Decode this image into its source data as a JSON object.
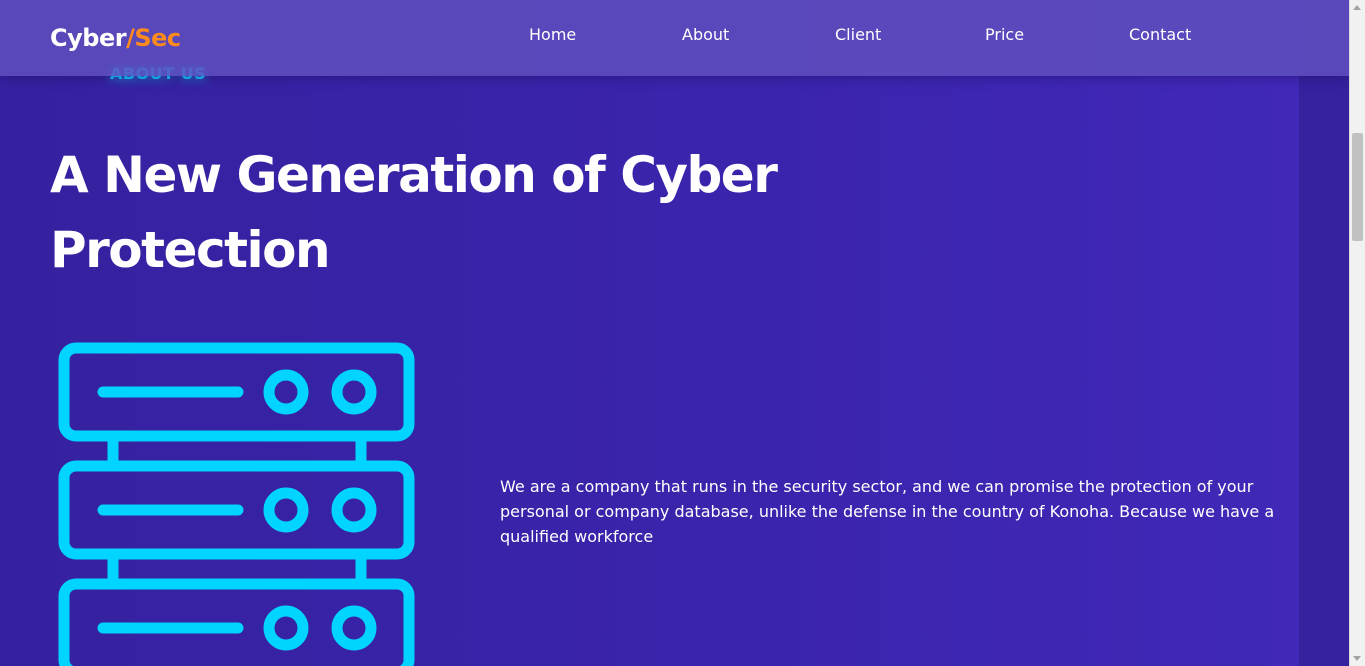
{
  "brand": {
    "name_part1": "Cyber",
    "separator": "/",
    "name_part2": "Sec",
    "accent_color": "#ff8a1d"
  },
  "nav": {
    "items": [
      {
        "label": "Home"
      },
      {
        "label": "About"
      },
      {
        "label": "Client"
      },
      {
        "label": "Price"
      },
      {
        "label": "Contact"
      }
    ]
  },
  "about": {
    "section_label": "ABOUT US",
    "headline": "A New Generation of Cyber Protection",
    "description": "We are a company that runs in the security sector, and we can promise the protection of your personal or company database, unlike the defense in the country of Konoha. Because we have a qualified workforce",
    "illustration_icon": "server-rack-icon"
  },
  "colors": {
    "background": "#3a22a8",
    "icon_cyan": "#00d4ff",
    "text": "#ffffff"
  }
}
